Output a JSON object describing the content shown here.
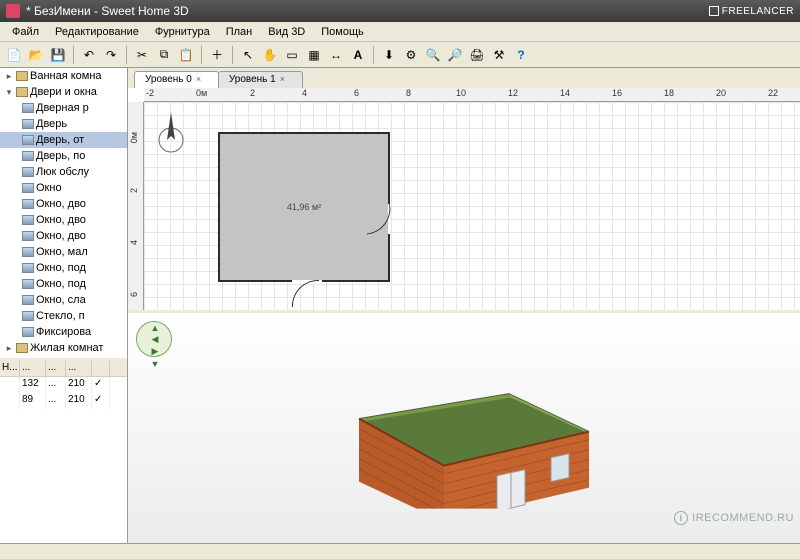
{
  "title": "* БезИмени - Sweet Home 3D",
  "freelancer_badge": "FREELANCER",
  "menu": [
    "Файл",
    "Редактирование",
    "Фурнитура",
    "План",
    "Вид 3D",
    "Помощь"
  ],
  "tabs": [
    {
      "label": "Уровень 0",
      "active": true
    },
    {
      "label": "Уровень 1",
      "active": false
    }
  ],
  "room_area": "41,96 м²",
  "hruler": [
    "-2",
    "0м",
    "2",
    "4",
    "6",
    "8",
    "10",
    "12",
    "14",
    "16",
    "18",
    "20",
    "22"
  ],
  "vruler": [
    "0м",
    "2",
    "4",
    "6"
  ],
  "catalog": {
    "root1": "Ванная комна",
    "root2": "Двери и окна",
    "items": [
      "Дверная р",
      "Дверь",
      "Дверь, от",
      "Дверь, по",
      "Люк обслу",
      "Окно",
      "Окно, дво",
      "Окно, дво",
      "Окно, дво",
      "Окно, мал",
      "Окно, под",
      "Окно, под",
      "Окно, сла",
      "Стекло, п",
      "Фиксирова"
    ],
    "root3": "Жилая комнат"
  },
  "furn_headers": [
    "Н...",
    "...",
    "...",
    "...",
    ""
  ],
  "furn_row": [
    "",
    "132",
    "...",
    "210",
    "✓"
  ],
  "furn_row2": [
    "",
    "89",
    "...",
    "210",
    "✓"
  ],
  "watermark": "IRECOMMEND.RU"
}
